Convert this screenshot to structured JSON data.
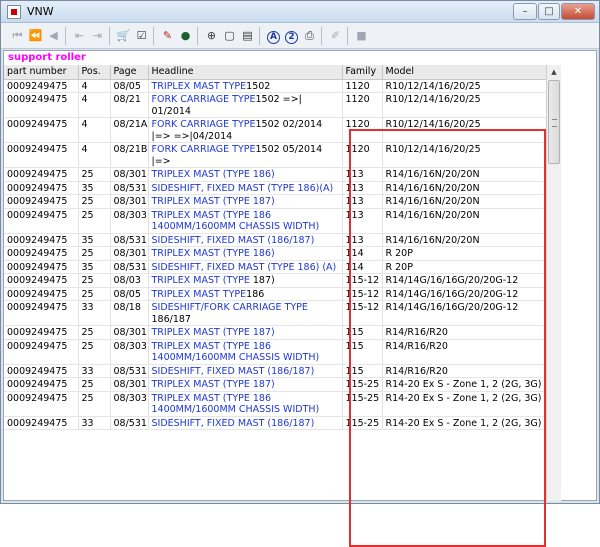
{
  "window": {
    "title": "VNW"
  },
  "titlebar_buttons": {
    "minimize": "–",
    "maximize": "□",
    "close": "✕"
  },
  "section_title": "support roller",
  "columns": {
    "part_number": "part number",
    "pos": "Pos.",
    "page": "Page",
    "headline": "Headline",
    "family": "Family",
    "model": "Model"
  },
  "rows": [
    {
      "part": "0009249475",
      "pos": "4",
      "page": "08/05",
      "headline": "TRIPLEX MAST TYPE",
      "extra": "1502",
      "family": "1120",
      "model": "R10/12/14/16/20/25"
    },
    {
      "part": "0009249475",
      "pos": "4",
      "page": "08/21",
      "headline": "FORK CARRIAGE TYPE",
      "extra": "1502 =>| 01/2014",
      "family": "1120",
      "model": "R10/12/14/16/20/25"
    },
    {
      "part": "0009249475",
      "pos": "4",
      "page": "08/21A",
      "headline": "FORK CARRIAGE TYPE",
      "extra": "1502 02/2014 |=> =>|04/2014",
      "family": "1120",
      "model": "R10/12/14/16/20/25"
    },
    {
      "part": "0009249475",
      "pos": "4",
      "page": "08/21B",
      "headline": "FORK CARRIAGE TYPE",
      "extra": "1502 05/2014 |=>",
      "family": "1120",
      "model": "R10/12/14/16/20/25"
    },
    {
      "part": "0009249475",
      "pos": "25",
      "page": "08/301",
      "headline": "TRIPLEX MAST (TYPE 186)",
      "extra": "",
      "family": "113",
      "model": "R14/16/16N/20/20N"
    },
    {
      "part": "0009249475",
      "pos": "35",
      "page": "08/531",
      "headline": "SIDESHIFT, FIXED MAST (TYPE 186)(A)",
      "extra": "",
      "family": "113",
      "model": "R14/16/16N/20/20N"
    },
    {
      "part": "0009249475",
      "pos": "25",
      "page": "08/301",
      "headline": "TRIPLEX MAST (TYPE 187)",
      "extra": "",
      "family": "113",
      "model": "R14/16/16N/20/20N"
    },
    {
      "part": "0009249475",
      "pos": "25",
      "page": "08/303",
      "headline": "TRIPLEX MAST (TYPE 186 1400MM/1600MM CHASSIS WIDTH)",
      "extra": "",
      "family": "113",
      "model": "R14/16/16N/20/20N"
    },
    {
      "part": "0009249475",
      "pos": "35",
      "page": "08/531",
      "headline": "SIDESHIFT, FIXED MAST (186/187)",
      "extra": "",
      "family": "113",
      "model": "R14/16/16N/20/20N"
    },
    {
      "part": "0009249475",
      "pos": "25",
      "page": "08/301",
      "headline": "TRIPLEX MAST (TYPE 186)",
      "extra": "",
      "family": "114",
      "model": "R 20P"
    },
    {
      "part": "0009249475",
      "pos": "35",
      "page": "08/531",
      "headline": "SIDESHIFT, FIXED MAST (TYPE 186) (A)",
      "extra": "",
      "family": "114",
      "model": "R 20P"
    },
    {
      "part": "0009249475",
      "pos": "25",
      "page": "08/03",
      "headline": "TRIPLEX MAST (TYPE ",
      "extra": "187)",
      "family": "115-12",
      "model": "R14/14G/16/16G/20/20G-12"
    },
    {
      "part": "0009249475",
      "pos": "25",
      "page": "08/05",
      "headline": "TRIPLEX MAST TYPE",
      "extra": "186",
      "family": "115-12",
      "model": "R14/14G/16/16G/20/20G-12"
    },
    {
      "part": "0009249475",
      "pos": "33",
      "page": "08/18",
      "headline": "SIDESHIFT/FORK CARRIAGE TYPE",
      "extra": " 186/187",
      "family": "115-12",
      "model": "R14/14G/16/16G/20/20G-12"
    },
    {
      "part": "0009249475",
      "pos": "25",
      "page": "08/301",
      "headline": "TRIPLEX MAST (TYPE 187)",
      "extra": "",
      "family": "115",
      "model": "R14/R16/R20"
    },
    {
      "part": "0009249475",
      "pos": "25",
      "page": "08/303",
      "headline": "TRIPLEX MAST (TYPE 186 1400MM/1600MM CHASSIS WIDTH)",
      "extra": "",
      "family": "115",
      "model": "R14/R16/R20"
    },
    {
      "part": "0009249475",
      "pos": "33",
      "page": "08/531",
      "headline": "SIDESHIFT, FIXED MAST (186/187)",
      "extra": "",
      "family": "115",
      "model": "R14/R16/R20"
    },
    {
      "part": "0009249475",
      "pos": "25",
      "page": "08/301",
      "headline": "TRIPLEX MAST (TYPE 187)",
      "extra": "",
      "family": "115-25",
      "model": "R14-20 Ex S - Zone 1, 2 (2G, 3G)"
    },
    {
      "part": "0009249475",
      "pos": "25",
      "page": "08/303",
      "headline": "TRIPLEX MAST (TYPE 186 1400MM/1600MM CHASSIS WIDTH)",
      "extra": "",
      "family": "115-25",
      "model": "R14-20 Ex S - Zone 1, 2 (2G, 3G)"
    },
    {
      "part": "0009249475",
      "pos": "33",
      "page": "08/531",
      "headline": "SIDESHIFT, FIXED MAST (186/187)",
      "extra": "",
      "family": "115-25",
      "model": "R14-20 Ex S - Zone 1, 2 (2G, 3G)"
    }
  ],
  "icons": {
    "accent_red": "#e03030",
    "link_blue": "#1f38d0",
    "section_magenta": "#ff00ff"
  }
}
